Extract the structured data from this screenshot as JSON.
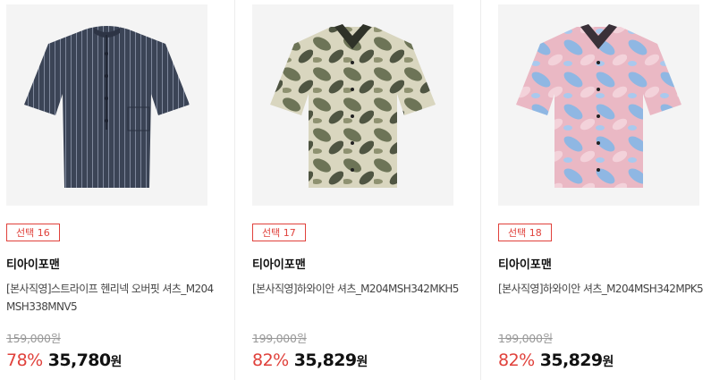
{
  "products": [
    {
      "badge": "선택 16",
      "brand": "티아이포맨",
      "name": "[본사직영]스트라이프 헨리넥 오버핏 셔츠_M204MSH338MNV5",
      "original_price": "159,000원",
      "discount_rate": "78%",
      "sale_price": "35,780",
      "currency": "원",
      "shirt_style": "navy-pinstripe",
      "colors": {
        "primary": "#3b4456",
        "accent": "#8d96a8"
      }
    },
    {
      "badge": "선택 17",
      "brand": "티아이포맨",
      "name": "[본사직영]하와이안 셔츠_M204MSH342MKH5",
      "original_price": "199,000원",
      "discount_rate": "82%",
      "sale_price": "35,829",
      "currency": "원",
      "shirt_style": "khaki-monstera-print",
      "colors": {
        "primary": "#6d7457",
        "accent": "#d9d6bf"
      }
    },
    {
      "badge": "선택 18",
      "brand": "티아이포맨",
      "name": "[본사직영]하와이안 셔츠_M204MSH342MPK5",
      "original_price": "199,000원",
      "discount_rate": "82%",
      "sale_price": "35,829",
      "currency": "원",
      "shirt_style": "pink-blue-leaf-print",
      "colors": {
        "primary": "#eab8c4",
        "accent": "#8fb7e3"
      }
    }
  ],
  "theme": {
    "badge_color": "#e0413b",
    "discount_color": "#e0413b",
    "image_bg": "#f4f4f4"
  }
}
